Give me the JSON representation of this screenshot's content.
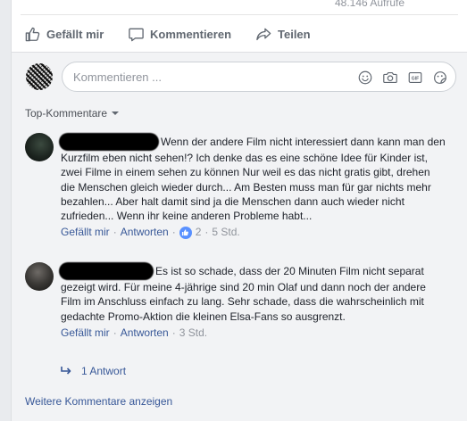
{
  "post": {
    "views": "48.146 Aufrufe"
  },
  "actions": {
    "like": "Gefällt mir",
    "comment": "Kommentieren",
    "share": "Teilen"
  },
  "composer": {
    "placeholder": "Kommentieren ...",
    "icons": [
      "emoji-icon",
      "camera-icon",
      "gif-icon",
      "sticker-icon"
    ]
  },
  "sort": {
    "label": "Top-Kommentare"
  },
  "comments": [
    {
      "text": "Wenn der andere Film nicht interessiert dann kann man den Kurzfilm eben nicht sehen!? Ich denke das es eine schöne Idee für Kinder ist, zwei Filme in einem sehen zu können Nur weil es das nicht gratis gibt, drehen die Menschen gleich wieder durch... Am Besten muss man für gar nichts mehr bezahlen... Aber halt damit sind ja die Menschen dann auch wieder nicht zufrieden... Wenn ihr keine anderen Probleme habt...",
      "like_label": "Gefällt mir",
      "reply_label": "Antworten",
      "reaction_count": "2",
      "time": "5 Std."
    },
    {
      "text": "Es ist so schade, dass der 20 Minuten Film nicht separat gezeigt wird. Für meine 4-jährige sind 20 min Olaf und dann noch der andere Film im Anschluss einfach zu lang. Sehr schade, dass die wahrscheinlich mit gedachte Promo-Aktion die kleinen Elsa-Fans so ausgrenzt.",
      "like_label": "Gefällt mir",
      "reply_label": "Antworten",
      "time": "3 Std.",
      "replies_label": "1 Antwort"
    }
  ],
  "footer": {
    "more_comments": "Weitere Kommentare anzeigen"
  },
  "colors": {
    "link": "#385898",
    "meta": "#90949c",
    "like_badge": "#5890ff",
    "page_bg": "#e9ebee",
    "composer_bg": "#f2f3f5"
  }
}
